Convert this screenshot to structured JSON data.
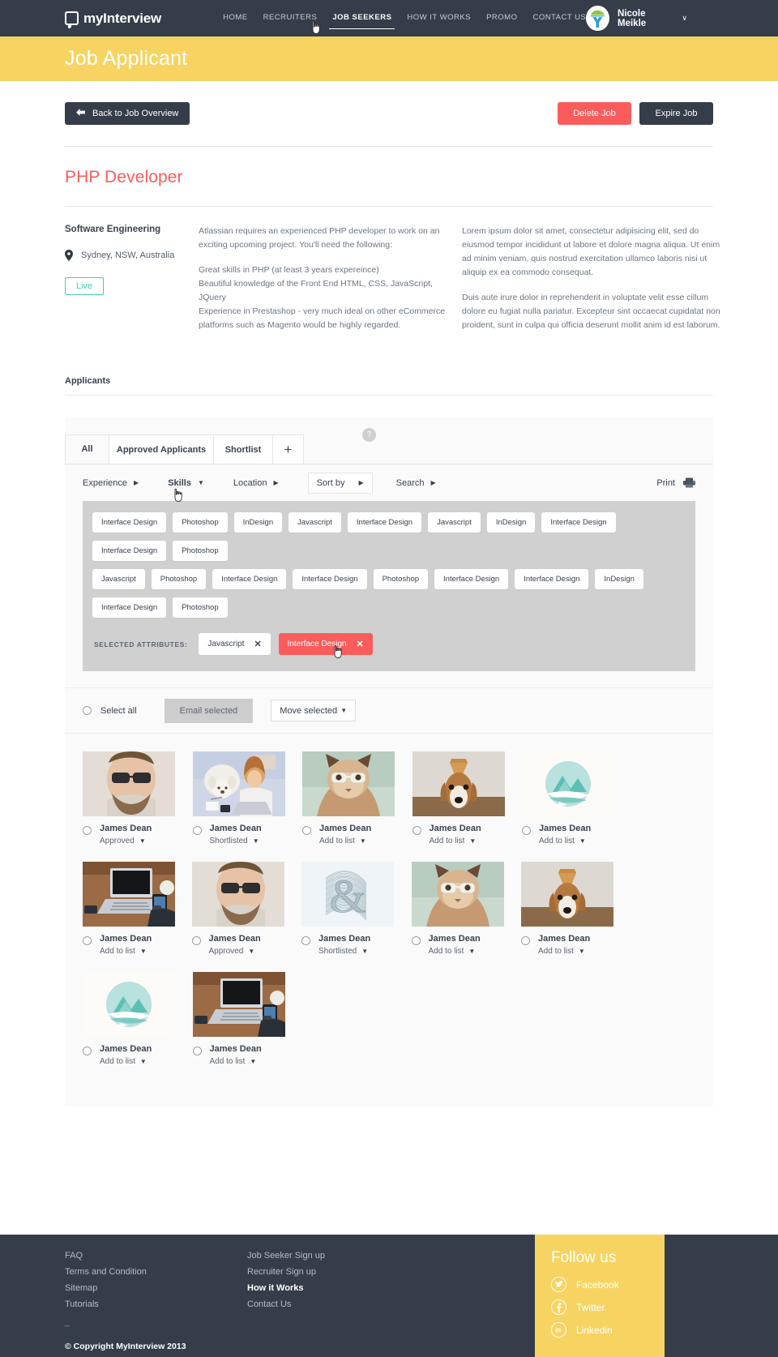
{
  "header": {
    "logo_text": "myInterview",
    "nav": [
      {
        "label": "HOME",
        "active": false
      },
      {
        "label": "RECRUITERS",
        "active": false
      },
      {
        "label": "JOB SEEKERS",
        "active": true
      },
      {
        "label": "HOW IT WORKS",
        "active": false
      },
      {
        "label": "PROMO",
        "active": false
      },
      {
        "label": "CONTACT US",
        "active": false
      }
    ],
    "username": "Nicole Meikle",
    "caret": "∨"
  },
  "banner": {
    "title": "Job Applicant"
  },
  "actions": {
    "back_label": "Back to Job Overview",
    "back_arrow": "⬅",
    "delete_label": "Delete Job",
    "expire_label": "Expire Job"
  },
  "job": {
    "title": "PHP Developer",
    "department": "Software Engineering",
    "location": "Sydney, NSW, Australia",
    "status_badge": "Live",
    "description_left": [
      "Atlassian requires an experienced PHP developer to work on an exciting upcoming project.  You'll need the following:",
      "Great skills in PHP (at least 3 years expereince)\nBeautiful knowledge of the Front End HTML, CSS, JavaScript, JQuery\nExperience in Prestashop - very much ideal on other eCommerce platforms such as Magento would be highly regarded."
    ],
    "description_right": [
      "Lorem ipsum dolor sit amet, consectetur adipisicing elit, sed do eiusmod tempor incididunt ut labore et dolore magna aliqua. Ut enim ad minim veniam, quis nostrud exercitation ullamco laboris nisi ut aliquip ex ea commodo consequat.",
      "Duis aute irure dolor in reprehenderit in voluptate velit esse cillum dolore eu fugiat nulla pariatur. Excepteur sint occaecat cupidatat non proident, sunt in culpa qui officia deserunt mollit anim id est laborum."
    ]
  },
  "applicants_section": {
    "label": "Applicants",
    "tabs": [
      {
        "label": "All",
        "active": true
      },
      {
        "label": "Approved Applicants",
        "active": false
      },
      {
        "label": "Shortlist",
        "active": false
      },
      {
        "label": "+",
        "active": false
      }
    ],
    "help_badge": "?",
    "filters": [
      {
        "label": "Experience",
        "marker": "▶",
        "bold": false
      },
      {
        "label": "Skills",
        "marker": "▼",
        "bold": true
      },
      {
        "label": "Location",
        "marker": "▶",
        "bold": false
      }
    ],
    "sort_by": {
      "label": "Sort by",
      "marker": "▶"
    },
    "search": {
      "label": "Search",
      "marker": "▶"
    },
    "print": {
      "label": "Print"
    },
    "tag_rows": [
      [
        "Interface Design",
        "Photoshop",
        "InDesign",
        "Javascript",
        "Interface Design",
        "Javascript",
        "InDesign",
        "Interface Design",
        "Interface Design",
        "Photoshop"
      ],
      [
        "Javascript",
        "Photoshop",
        "Interface Design",
        "Interface Design",
        "Photoshop",
        "Interface Design",
        "Interface Design",
        "InDesign",
        "Interface Design",
        "Photoshop"
      ]
    ],
    "selected_attributes_label": "SELECTED ATTRIBUTES:",
    "selected_attributes": [
      {
        "label": "Javascript",
        "active": false,
        "close": "✕"
      },
      {
        "label": "Interface Design",
        "active": true,
        "close": "✕"
      }
    ],
    "select_all_label": "Select all",
    "email_selected_label": "Email selected",
    "move_selected_label": "Move selected",
    "move_selected_marker": "▼",
    "cards": [
      {
        "name": "James Dean",
        "status": "Approved",
        "marker": "▼",
        "thumb": "man-glasses-photo"
      },
      {
        "name": "James Dean",
        "status": "Shortlisted",
        "marker": "▼",
        "thumb": "woman-dog-laptop-photo"
      },
      {
        "name": "James Dean",
        "status": "Add to list",
        "marker": "▼",
        "thumb": "cat-glasses-photo"
      },
      {
        "name": "James Dean",
        "status": "Add to list",
        "marker": "▼",
        "thumb": "dog-icecream-photo"
      },
      {
        "name": "James Dean",
        "status": "Add to list",
        "marker": "▼",
        "thumb": "mountain-logo-graphic"
      },
      {
        "name": "James Dean",
        "status": "Add to list",
        "marker": "▼",
        "thumb": "laptop-phone-desk-photo"
      },
      {
        "name": "James Dean",
        "status": "Approved",
        "marker": "▼",
        "thumb": "man-glasses-photo"
      },
      {
        "name": "James Dean",
        "status": "Shortlisted",
        "marker": "▼",
        "thumb": "ampersand-graphic"
      },
      {
        "name": "James Dean",
        "status": "Add to list",
        "marker": "▼",
        "thumb": "cat-glasses-photo"
      },
      {
        "name": "James Dean",
        "status": "Add to list",
        "marker": "▼",
        "thumb": "dog-icecream-photo"
      },
      {
        "name": "James Dean",
        "status": "Add to list",
        "marker": "▼",
        "thumb": "mountain-logo-graphic"
      },
      {
        "name": "James Dean",
        "status": "Add to list",
        "marker": "▼",
        "thumb": "laptop-phone-desk-photo"
      }
    ]
  },
  "footer": {
    "col1": [
      {
        "label": "FAQ",
        "bold": false
      },
      {
        "label": "Terms and Condition",
        "bold": false
      },
      {
        "label": "Sitemap",
        "bold": false
      },
      {
        "label": "Tutorials",
        "bold": false
      }
    ],
    "col2": [
      {
        "label": "Job Seeker Sign up",
        "bold": false
      },
      {
        "label": "Recruiter Sign up",
        "bold": false
      },
      {
        "label": "How it Works",
        "bold": true
      },
      {
        "label": "Contact Us",
        "bold": false
      }
    ],
    "dash": "_",
    "copyright": "© Copyright MyInterview 2013",
    "follow_title": "Follow us",
    "socials": [
      {
        "label": "Facebook",
        "icon": "twitter-bird-icon"
      },
      {
        "label": "Twitter",
        "icon": "facebook-f-icon"
      },
      {
        "label": "Linkedin",
        "icon": "linkedin-in-icon"
      }
    ]
  },
  "colors": {
    "dark": "#343d49",
    "yellow": "#f7d462",
    "red": "#fa5c5c",
    "teal": "#3fcfb0",
    "panel": "#fafafa",
    "tagcloud": "#d0d0d0"
  }
}
